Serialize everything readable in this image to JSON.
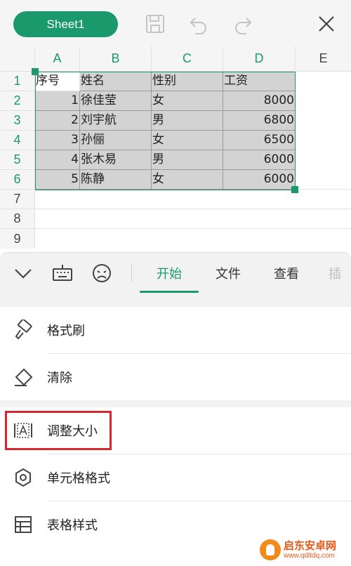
{
  "toolbar": {
    "sheet_name": "Sheet1",
    "save_icon": "save-icon",
    "undo_icon": "undo-icon",
    "redo_icon": "redo-icon",
    "close_icon": "close-icon"
  },
  "sheet": {
    "columns": [
      "A",
      "B",
      "C",
      "D",
      "E"
    ],
    "rows": [
      "1",
      "2",
      "3",
      "4",
      "5",
      "6",
      "7",
      "8",
      "9"
    ],
    "cells": [
      [
        "序号",
        "姓名",
        "性别",
        "工资"
      ],
      [
        "1",
        "徐佳莹",
        "女",
        "8000"
      ],
      [
        "2",
        "刘宇航",
        "男",
        "6800"
      ],
      [
        "3",
        "孙俪",
        "女",
        "6500"
      ],
      [
        "4",
        "张木易",
        "男",
        "6000"
      ],
      [
        "5",
        "陈静",
        "女",
        "6000"
      ]
    ],
    "accent_color": "#1a9a6c"
  },
  "panel": {
    "tabs": [
      {
        "label": "开始",
        "active": true
      },
      {
        "label": "文件",
        "active": false
      },
      {
        "label": "查看",
        "active": false
      },
      {
        "label": "插",
        "active": false
      }
    ],
    "items": [
      {
        "label": "格式刷",
        "icon": "format-painter-icon"
      },
      {
        "label": "清除",
        "icon": "eraser-icon"
      },
      {
        "label": "调整大小",
        "icon": "resize-icon"
      },
      {
        "label": "单元格格式",
        "icon": "gear-icon"
      },
      {
        "label": "表格样式",
        "icon": "table-style-icon"
      }
    ],
    "highlight_color": "#d6262e"
  },
  "watermark": {
    "name": "启东安卓网",
    "url": "www.qdltdq.com"
  }
}
